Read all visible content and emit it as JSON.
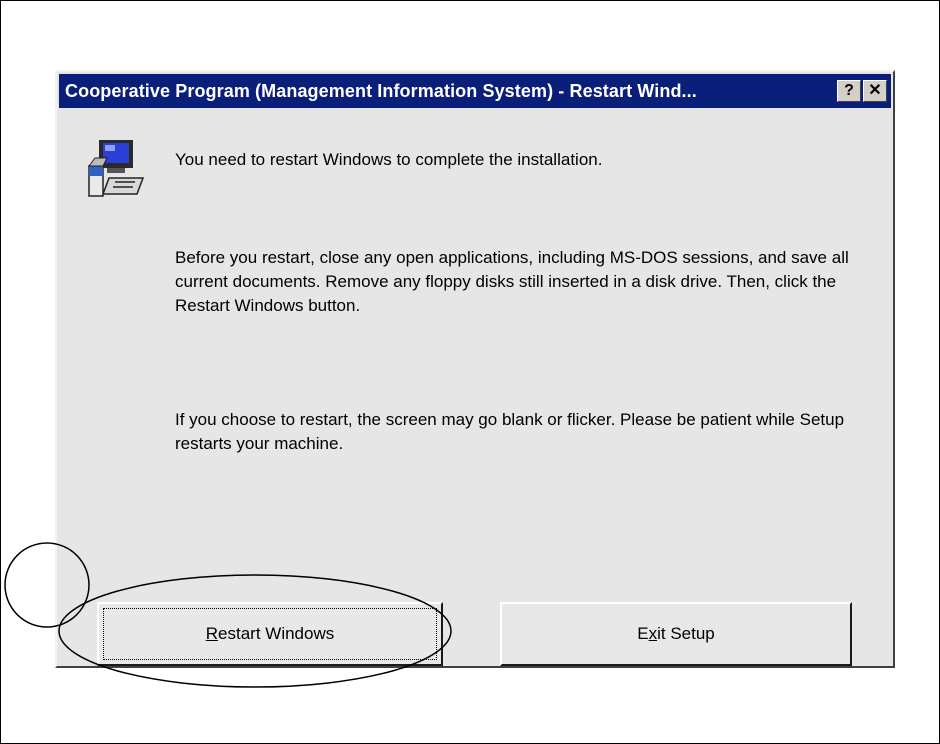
{
  "dialog": {
    "title": "Cooperative Program (Management Information System) - Restart Wind...",
    "help_glyph": "?",
    "close_glyph": "✕",
    "icon": "setup-computer-icon",
    "message_1": "You need to restart Windows to complete the installation.",
    "message_2": "Before you restart, close any open applications, including MS-DOS sessions, and save all current documents. Remove any floppy disks still inserted in a disk drive. Then, click the Restart Windows button.",
    "message_3": "If you choose to restart, the screen may go blank or flicker.  Please be patient while Setup restarts your machine.",
    "restart_button": {
      "accel": "R",
      "rest": "estart Windows"
    },
    "exit_button": {
      "pre": "E",
      "accel": "x",
      "rest": "it Setup"
    }
  },
  "colors": {
    "titlebar": "#0a1f7a",
    "dialog_face": "#e6e6e6"
  }
}
